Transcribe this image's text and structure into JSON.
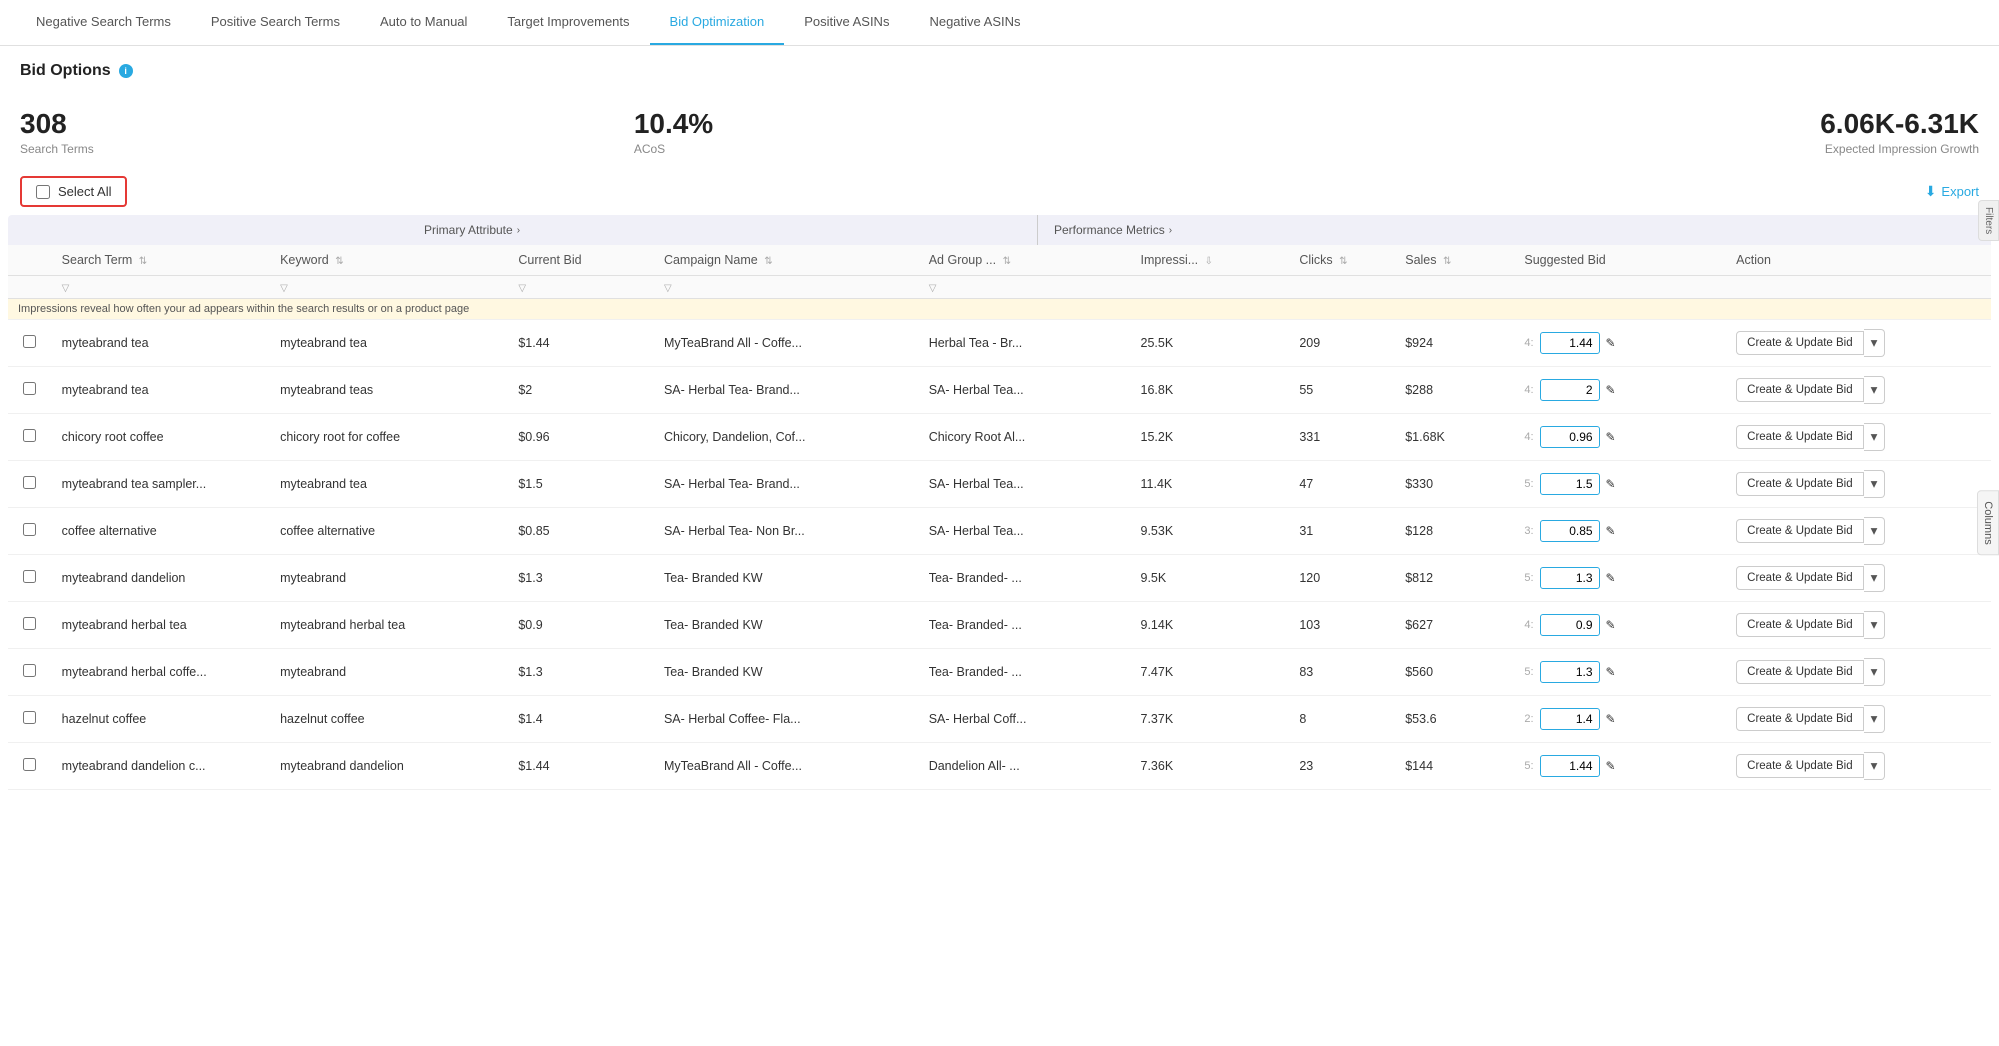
{
  "nav": {
    "tabs": [
      {
        "id": "negative-search",
        "label": "Negative Search Terms",
        "active": false
      },
      {
        "id": "positive-search",
        "label": "Positive Search Terms",
        "active": false
      },
      {
        "id": "auto-to-manual",
        "label": "Auto to Manual",
        "active": false
      },
      {
        "id": "target-improvements",
        "label": "Target Improvements",
        "active": false
      },
      {
        "id": "bid-optimization",
        "label": "Bid Optimization",
        "active": true
      },
      {
        "id": "positive-asins",
        "label": "Positive ASINs",
        "active": false
      },
      {
        "id": "negative-asins",
        "label": "Negative ASINs",
        "active": false
      }
    ]
  },
  "bid_options": {
    "title": "Bid Options",
    "info_label": "i"
  },
  "stats": {
    "search_terms_count": "308",
    "search_terms_label": "Search Terms",
    "acos_value": "10.4%",
    "acos_label": "ACoS",
    "impression_growth": "6.06K-6.31K",
    "impression_growth_label": "Expected Impression Growth"
  },
  "controls": {
    "select_all": "Select All",
    "export": "Export"
  },
  "section_headers": {
    "primary": "Primary Attribute",
    "performance": "Performance Metrics"
  },
  "table": {
    "columns": [
      {
        "id": "checkbox",
        "label": ""
      },
      {
        "id": "search_term",
        "label": "Search Term",
        "sortable": true
      },
      {
        "id": "keyword",
        "label": "Keyword",
        "sortable": true
      },
      {
        "id": "current_bid",
        "label": "Current Bid"
      },
      {
        "id": "campaign_name",
        "label": "Campaign Name",
        "sortable": true
      },
      {
        "id": "ad_group",
        "label": "Ad Group ...",
        "sortable": true
      },
      {
        "id": "impressions",
        "label": "Impressi...",
        "sortable": true,
        "sort_desc": true
      },
      {
        "id": "clicks",
        "label": "Clicks",
        "sortable": true
      },
      {
        "id": "sales",
        "label": "Sales",
        "sortable": true
      },
      {
        "id": "suggested_bid",
        "label": "Suggested Bid"
      },
      {
        "id": "action",
        "label": "Action"
      }
    ],
    "impressions_tooltip": "Impressions reveal how often your ad appears within the search results or on a product page",
    "rows": [
      {
        "search_term": "myteabrand tea",
        "keyword": "myteabrand tea",
        "current_bid": "$1.44",
        "campaign_name": "MyTeaBrand All - Coffe...",
        "ad_group": "Herbal Tea - Br...",
        "impressions": "25.5K",
        "clicks": "209",
        "sales": "$924",
        "suggested_bid_col4": "4:",
        "suggested_bid": "1.44",
        "action": "Create & Update Bid",
        "highlighted": true
      },
      {
        "search_term": "myteabrand tea",
        "keyword": "myteabrand teas",
        "current_bid": "$2",
        "campaign_name": "SA- Herbal Tea- Brand...",
        "ad_group": "SA- Herbal Tea...",
        "impressions": "16.8K",
        "clicks": "55",
        "sales": "$288",
        "suggested_bid_col4": "4:",
        "suggested_bid": "2",
        "action": "Create & Update Bid"
      },
      {
        "search_term": "chicory root coffee",
        "keyword": "chicory root for coffee",
        "current_bid": "$0.96",
        "campaign_name": "Chicory, Dandelion, Cof...",
        "ad_group": "Chicory Root Al...",
        "impressions": "15.2K",
        "clicks": "331",
        "sales": "$1.68K",
        "suggested_bid_col4": "4:",
        "suggested_bid": "0.96",
        "action": "Create & Update Bid"
      },
      {
        "search_term": "myteabrand tea sampler...",
        "keyword": "myteabrand tea",
        "current_bid": "$1.5",
        "campaign_name": "SA- Herbal Tea- Brand...",
        "ad_group": "SA- Herbal Tea...",
        "impressions": "11.4K",
        "clicks": "47",
        "sales": "$330",
        "suggested_bid_col4": "5:",
        "suggested_bid": "1.5",
        "action": "Create & Update Bid"
      },
      {
        "search_term": "coffee alternative",
        "keyword": "coffee alternative",
        "current_bid": "$0.85",
        "campaign_name": "SA- Herbal Tea- Non Br...",
        "ad_group": "SA- Herbal Tea...",
        "impressions": "9.53K",
        "clicks": "31",
        "sales": "$128",
        "suggested_bid_col4": "3:",
        "suggested_bid": "0.85",
        "action": "Create & Update Bid"
      },
      {
        "search_term": "myteabrand dandelion",
        "keyword": "myteabrand",
        "current_bid": "$1.3",
        "campaign_name": "Tea- Branded KW",
        "ad_group": "Tea- Branded- ...",
        "impressions": "9.5K",
        "clicks": "120",
        "sales": "$812",
        "suggested_bid_col4": "5:",
        "suggested_bid": "1.3",
        "action": "Create & Update Bid"
      },
      {
        "search_term": "myteabrand herbal tea",
        "keyword": "myteabrand herbal tea",
        "current_bid": "$0.9",
        "campaign_name": "Tea- Branded KW",
        "ad_group": "Tea- Branded- ...",
        "impressions": "9.14K",
        "clicks": "103",
        "sales": "$627",
        "suggested_bid_col4": "4:",
        "suggested_bid": "0.9",
        "action": "Create & Update Bid"
      },
      {
        "search_term": "myteabrand herbal coffe...",
        "keyword": "myteabrand",
        "current_bid": "$1.3",
        "campaign_name": "Tea- Branded KW",
        "ad_group": "Tea- Branded- ...",
        "impressions": "7.47K",
        "clicks": "83",
        "sales": "$560",
        "suggested_bid_col4": "5:",
        "suggested_bid": "1.3",
        "action": "Create & Update Bid"
      },
      {
        "search_term": "hazelnut coffee",
        "keyword": "hazelnut coffee",
        "current_bid": "$1.4",
        "campaign_name": "SA- Herbal Coffee- Fla...",
        "ad_group": "SA- Herbal Coff...",
        "impressions": "7.37K",
        "clicks": "8",
        "sales": "$53.6",
        "suggested_bid_col4": "2:",
        "suggested_bid": "1.4",
        "action": "Create & Update Bid"
      },
      {
        "search_term": "myteabrand dandelion c...",
        "keyword": "myteabrand dandelion",
        "current_bid": "$1.44",
        "campaign_name": "MyTeaBrand All - Coffe...",
        "ad_group": "Dandelion All- ...",
        "impressions": "7.36K",
        "clicks": "23",
        "sales": "$144",
        "suggested_bid_col4": "5:",
        "suggested_bid": "1.44",
        "action": "Create & Update Bid"
      }
    ]
  },
  "sidebar": {
    "columns_label": "Columns",
    "filters_label": "Filters"
  }
}
